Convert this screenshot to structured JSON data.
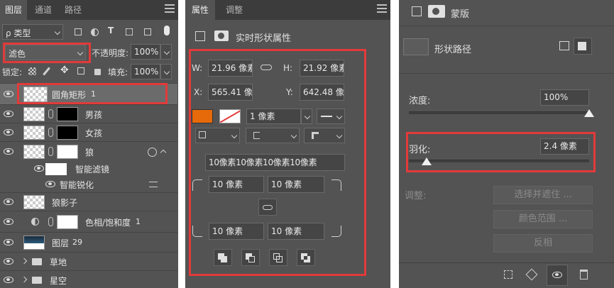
{
  "layers_panel": {
    "tabs": [
      "图层",
      "通道",
      "路径"
    ],
    "filter_label": "ρ 类型",
    "blend_mode": "滤色",
    "opacity_label": "不透明度:",
    "opacity_value": "100%",
    "lock_label": "锁定:",
    "fill_label": "填充:",
    "fill_value": "100%",
    "layers": [
      {
        "name": "圆角矩形",
        "suffix": "1"
      },
      {
        "name": "男孩",
        "suffix": ""
      },
      {
        "name": "女孩",
        "suffix": ""
      },
      {
        "name": "狼",
        "suffix": ""
      },
      {
        "name": "智能滤镜",
        "suffix": ""
      },
      {
        "name": "智能锐化",
        "suffix": ""
      },
      {
        "name": "狼影子",
        "suffix": ""
      },
      {
        "name": "色相/饱和度",
        "suffix": "1"
      },
      {
        "name": "图层",
        "suffix": "29"
      },
      {
        "name": "草地",
        "suffix": ""
      },
      {
        "name": "星空",
        "suffix": ""
      }
    ]
  },
  "properties_panel": {
    "tabs": [
      "属性",
      "调整"
    ],
    "section_title": "实时形状属性",
    "w_label": "W:",
    "w_value": "21.96 像素",
    "h_label": "H:",
    "h_value": "21.92 像素",
    "x_label": "X:",
    "x_value": "565.41 像",
    "y_label": "Y:",
    "y_value": "642.48 像",
    "stroke_width": "1 像素",
    "fill_color": "#e66a0a",
    "corner_all": "10像素10像素10像素10像素",
    "corner_tl": "10 像素",
    "corner_tr": "10 像素",
    "corner_bl": "10 像素",
    "corner_br": "10 像素"
  },
  "mask_panel": {
    "title": "蒙版",
    "path_label": "形状路径",
    "density_label": "浓度:",
    "density_value": "100%",
    "density_level": 1.0,
    "feather_label": "羽化:",
    "feather_value": "2.4 像素",
    "feather_level": 0.1,
    "adjust_label": "调整:",
    "btn_select_mask": "选择并遮住 ...",
    "btn_color_range": "颜色范围 ...",
    "btn_invert": "反相"
  },
  "colors": {
    "highlight": "#e23a3a",
    "panel_bg": "#535353"
  }
}
